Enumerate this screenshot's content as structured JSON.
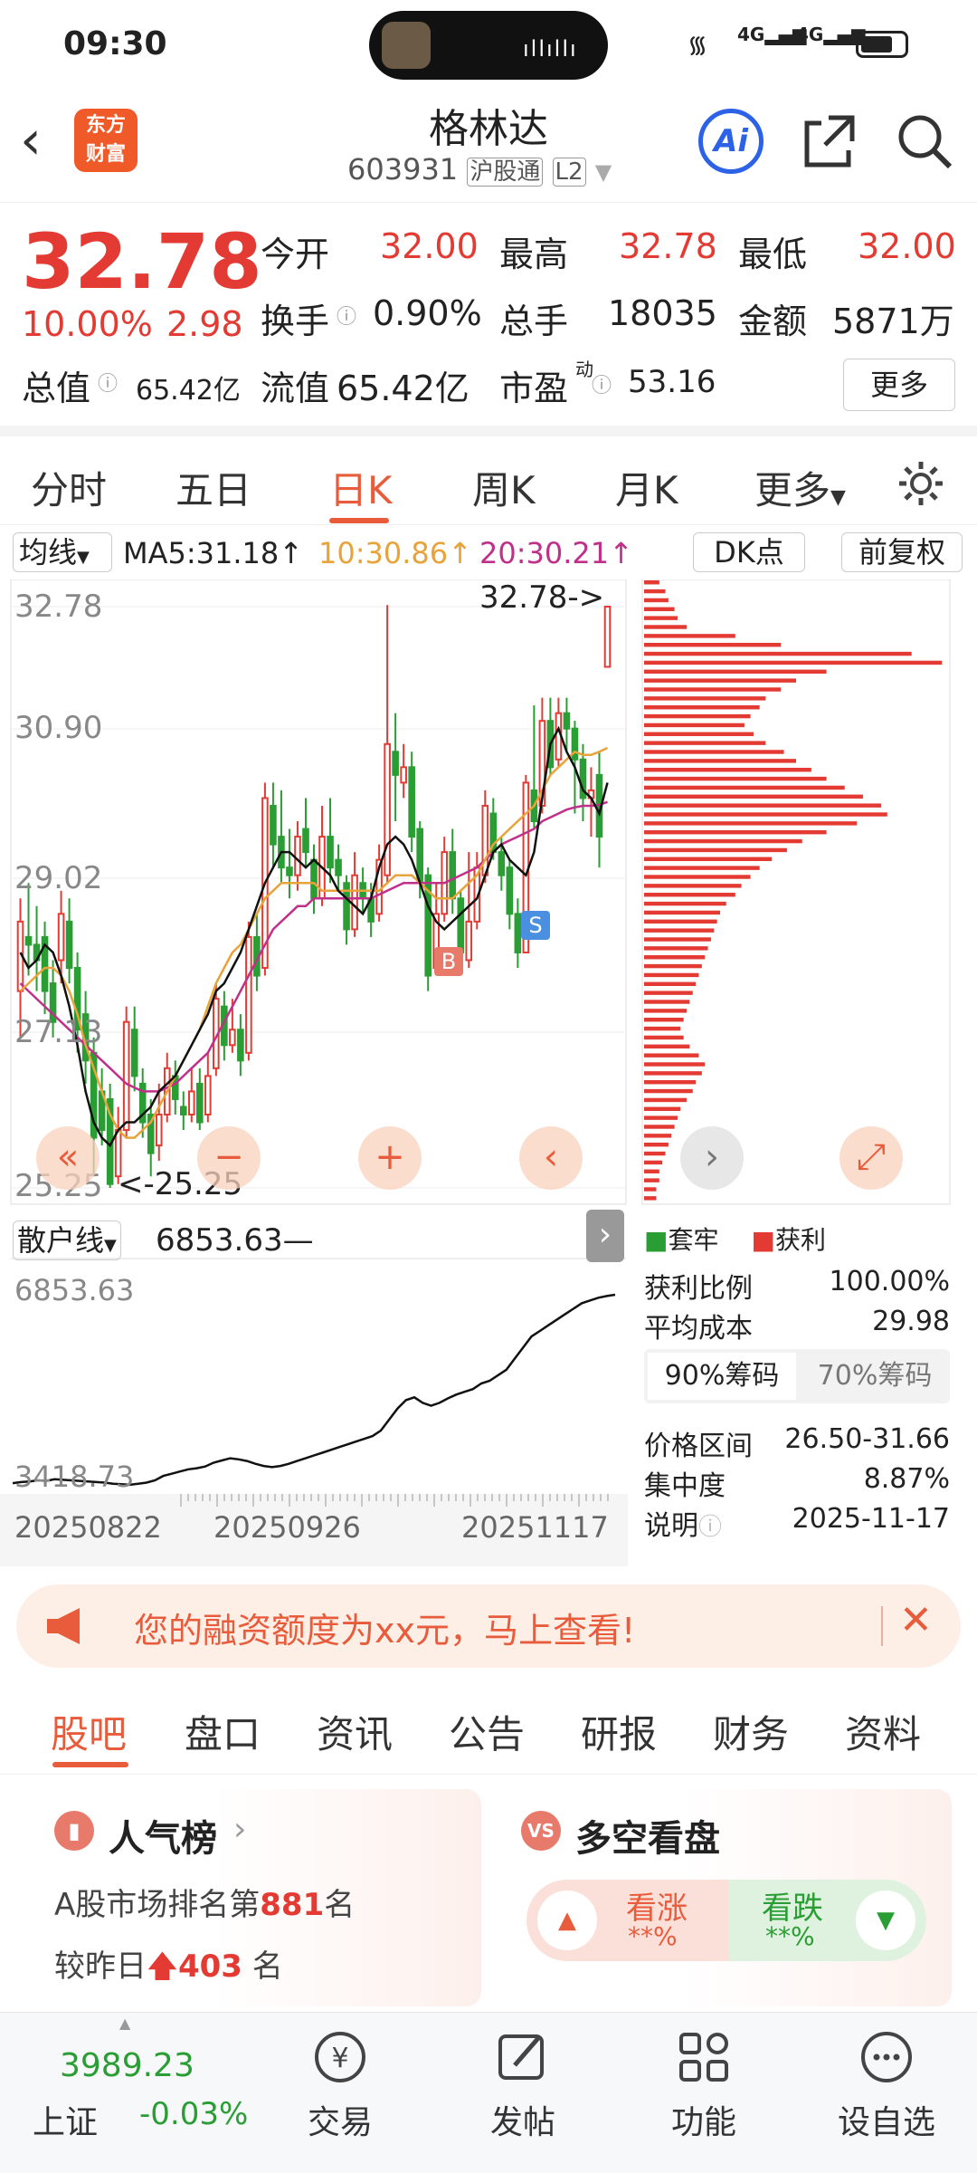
{
  "status": {
    "time": "09:30",
    "net1": "4G",
    "net2": "4G"
  },
  "header": {
    "logo_top": "东方",
    "logo_bottom": "财富",
    "title": "格林达",
    "code": "603931",
    "market": "沪股通",
    "level": "L2",
    "ai_label": "Ai"
  },
  "quote": {
    "price": "32.78",
    "pct": "10.00%",
    "change": "2.98",
    "open_label": "今开",
    "open": "32.00",
    "high_label": "最高",
    "high": "32.78",
    "low_label": "最低",
    "low": "32.00",
    "turnover_label": "换手",
    "turnover": "0.90%",
    "volume_label": "总手",
    "volume": "18035",
    "amount_label": "金额",
    "amount": "5871万",
    "mktcap_label": "总值",
    "mktcap": "65.42亿",
    "float_label": "流值",
    "float": "65.42亿",
    "pe_label": "市盈",
    "pe_sup": "动",
    "pe": "53.16",
    "more": "更多"
  },
  "periods": [
    "分时",
    "五日",
    "日K",
    "周K",
    "月K",
    "更多"
  ],
  "active_period": "日K",
  "indicator": {
    "ma_label": "均线",
    "ma5": "MA5:31.18↑",
    "ma10": "10:30.86↑",
    "ma20": "20:30.21↑",
    "dk": "DK点",
    "fq": "前复权"
  },
  "kline": {
    "y_labels": [
      "32.78",
      "30.90",
      "29.02",
      "27.13",
      "25.25"
    ],
    "max_annot": "32.78->",
    "min_annot": "<-25.25",
    "b_marker": "B",
    "s_marker": "S",
    "candles": [
      [
        27.8,
        28.7,
        27.2,
        29.0
      ],
      [
        28.5,
        28.4,
        28.0,
        29.2
      ],
      [
        28.4,
        28.2,
        27.8,
        28.9
      ],
      [
        28.5,
        27.8,
        27.5,
        28.7
      ],
      [
        27.9,
        27.4,
        27.2,
        28.2
      ],
      [
        28.2,
        28.8,
        27.9,
        29.1
      ],
      [
        28.7,
        28.1,
        27.9,
        29.0
      ],
      [
        28.1,
        27.3,
        27.0,
        28.3
      ],
      [
        27.5,
        26.9,
        26.6,
        27.8
      ],
      [
        27.0,
        25.9,
        25.4,
        27.2
      ],
      [
        26.5,
        26.0,
        25.8,
        26.8
      ],
      [
        26.4,
        25.3,
        25.25,
        26.6
      ],
      [
        25.4,
        26.0,
        25.3,
        26.3
      ],
      [
        26.0,
        27.4,
        25.9,
        27.6
      ],
      [
        27.3,
        26.7,
        26.5,
        27.6
      ],
      [
        26.6,
        26.1,
        25.9,
        26.8
      ],
      [
        26.2,
        25.7,
        25.4,
        26.4
      ],
      [
        25.8,
        26.2,
        25.6,
        26.6
      ],
      [
        26.2,
        26.8,
        26.1,
        27.0
      ],
      [
        26.7,
        26.4,
        26.2,
        26.9
      ],
      [
        26.3,
        26.2,
        26.0,
        26.5
      ],
      [
        26.2,
        26.5,
        26.1,
        26.8
      ],
      [
        26.6,
        26.1,
        26.0,
        26.8
      ],
      [
        26.2,
        26.7,
        26.1,
        27.0
      ],
      [
        26.8,
        27.7,
        26.7,
        27.9
      ],
      [
        27.6,
        27.1,
        26.9,
        27.8
      ],
      [
        27.1,
        27.3,
        27.0,
        27.7
      ],
      [
        27.3,
        26.9,
        26.7,
        27.5
      ],
      [
        27.0,
        28.5,
        26.9,
        28.7
      ],
      [
        28.5,
        28.0,
        27.8,
        28.8
      ],
      [
        28.1,
        30.3,
        28.0,
        30.5
      ],
      [
        30.2,
        29.7,
        29.4,
        30.5
      ],
      [
        29.8,
        29.4,
        29.2,
        30.4
      ],
      [
        29.4,
        29.3,
        29.0,
        29.9
      ],
      [
        29.3,
        29.8,
        29.1,
        30.0
      ],
      [
        29.9,
        29.6,
        29.4,
        30.3
      ],
      [
        29.5,
        29.0,
        28.8,
        29.7
      ],
      [
        29.0,
        29.8,
        28.9,
        30.2
      ],
      [
        29.8,
        29.4,
        29.2,
        30.3
      ],
      [
        29.5,
        29.3,
        29.1,
        29.7
      ],
      [
        29.2,
        28.6,
        28.4,
        29.3
      ],
      [
        28.6,
        29.3,
        28.5,
        29.6
      ],
      [
        29.2,
        29.0,
        28.8,
        29.4
      ],
      [
        29.0,
        28.7,
        28.5,
        29.2
      ],
      [
        28.8,
        29.5,
        28.7,
        29.7
      ],
      [
        29.3,
        31.0,
        29.2,
        32.8
      ],
      [
        30.9,
        30.6,
        30.0,
        31.4
      ],
      [
        30.5,
        30.7,
        30.3,
        31.0
      ],
      [
        30.7,
        29.8,
        29.6,
        30.9
      ],
      [
        29.9,
        29.2,
        29.0,
        30.0
      ],
      [
        29.3,
        28.0,
        27.8,
        29.4
      ],
      [
        28.1,
        28.8,
        28.0,
        29.2
      ],
      [
        28.8,
        29.6,
        28.7,
        29.8
      ],
      [
        29.6,
        29.0,
        28.8,
        29.9
      ],
      [
        29.0,
        28.3,
        28.1,
        29.1
      ],
      [
        28.2,
        28.7,
        28.1,
        29.6
      ],
      [
        28.7,
        29.4,
        28.6,
        29.6
      ],
      [
        29.3,
        30.2,
        29.2,
        30.4
      ],
      [
        30.1,
        29.6,
        29.5,
        30.3
      ],
      [
        29.6,
        29.3,
        29.1,
        29.8
      ],
      [
        29.4,
        28.8,
        28.6,
        29.5
      ],
      [
        28.8,
        28.3,
        28.1,
        29.0
      ],
      [
        28.3,
        30.5,
        28.3,
        30.6
      ],
      [
        30.4,
        30.0,
        29.9,
        31.5
      ],
      [
        30.2,
        31.3,
        30.1,
        31.6
      ],
      [
        31.3,
        30.7,
        30.6,
        31.6
      ],
      [
        30.8,
        31.4,
        30.7,
        31.6
      ],
      [
        31.4,
        31.2,
        30.9,
        31.6
      ],
      [
        31.2,
        30.8,
        30.1,
        31.3
      ],
      [
        30.8,
        30.3,
        30.0,
        31.0
      ],
      [
        30.3,
        30.4,
        29.8,
        30.7
      ],
      [
        30.6,
        29.8,
        29.4,
        30.9
      ],
      [
        32.0,
        32.78,
        32.0,
        32.78
      ]
    ],
    "ma_black": [
      28.3,
      28.1,
      28.2,
      28.4,
      28.3,
      28.0,
      27.6,
      27.1,
      26.5,
      26.1,
      25.9,
      25.8,
      26.0,
      26.1,
      26.1,
      26.2,
      26.3,
      26.5,
      26.6,
      26.7,
      26.9,
      27.1,
      27.3,
      27.5,
      27.8,
      27.9,
      28.1,
      28.3,
      28.6,
      28.9,
      29.2,
      29.4,
      29.6,
      29.6,
      29.5,
      29.4,
      29.5,
      29.4,
      29.3,
      29.1,
      29.0,
      28.9,
      28.8,
      29.0,
      29.4,
      29.7,
      29.8,
      29.7,
      29.5,
      29.2,
      28.9,
      28.7,
      28.6,
      28.7,
      28.8,
      28.9,
      29.0,
      29.3,
      29.6,
      29.7,
      29.5,
      29.4,
      29.3,
      29.6,
      30.3,
      31.0,
      31.2,
      30.9,
      30.7,
      30.4,
      30.3,
      30.1,
      30.5
    ],
    "ma_yellow": [
      27.8,
      27.9,
      28.0,
      28.1,
      28.1,
      28.0,
      27.8,
      27.5,
      27.1,
      26.8,
      26.5,
      26.2,
      26.0,
      25.9,
      25.9,
      26.0,
      26.1,
      26.3,
      26.5,
      26.7,
      26.9,
      27.1,
      27.3,
      27.6,
      27.9,
      28.1,
      28.3,
      28.4,
      28.6,
      28.8,
      29.0,
      29.1,
      29.2,
      29.2,
      29.2,
      29.2,
      29.2,
      29.1,
      29.1,
      29.1,
      29.1,
      29.1,
      29.1,
      29.1,
      29.1,
      29.2,
      29.3,
      29.3,
      29.3,
      29.2,
      29.1,
      29.0,
      29.0,
      29.0,
      29.1,
      29.2,
      29.3,
      29.5,
      29.7,
      29.8,
      29.9,
      30.0,
      30.1,
      30.2,
      30.4,
      30.6,
      30.7,
      30.8,
      30.9,
      30.86,
      30.86,
      30.9,
      30.95
    ],
    "ma_pink": [
      27.9,
      27.8,
      27.7,
      27.6,
      27.5,
      27.4,
      27.3,
      27.2,
      27.1,
      27.0,
      26.9,
      26.8,
      26.7,
      26.6,
      26.55,
      26.5,
      26.5,
      26.5,
      26.55,
      26.6,
      26.7,
      26.8,
      26.9,
      27.0,
      27.2,
      27.4,
      27.6,
      27.8,
      28.0,
      28.2,
      28.4,
      28.6,
      28.7,
      28.8,
      28.9,
      28.9,
      29.0,
      29.0,
      29.0,
      29.0,
      29.0,
      29.0,
      29.0,
      29.0,
      29.05,
      29.1,
      29.15,
      29.2,
      29.2,
      29.2,
      29.2,
      29.2,
      29.2,
      29.25,
      29.3,
      29.35,
      29.4,
      29.5,
      29.6,
      29.7,
      29.75,
      29.8,
      29.85,
      29.9,
      30.0,
      30.05,
      30.1,
      30.15,
      30.18,
      30.2,
      30.2,
      30.21,
      30.25
    ]
  },
  "chips": {
    "legend_trapped": "套牢",
    "legend_profit": "获利",
    "ratio_label": "获利比例",
    "ratio": "100.00%",
    "avg_label": "平均成本",
    "avg": "29.98",
    "tab90": "90%筹码",
    "tab70": "70%筹码",
    "range_label": "价格区间",
    "range": "26.50-31.66",
    "conc_label": "集中度",
    "conc": "8.87%",
    "note_label": "说明",
    "date": "2025-11-17",
    "bars": [
      0.05,
      0.07,
      0.08,
      0.1,
      0.11,
      0.14,
      0.3,
      0.45,
      0.88,
      0.98,
      0.6,
      0.5,
      0.45,
      0.4,
      0.38,
      0.35,
      0.33,
      0.36,
      0.4,
      0.46,
      0.5,
      0.55,
      0.6,
      0.66,
      0.72,
      0.78,
      0.8,
      0.7,
      0.6,
      0.52,
      0.47,
      0.42,
      0.38,
      0.35,
      0.32,
      0.3,
      0.27,
      0.25,
      0.24,
      0.23,
      0.22,
      0.21,
      0.2,
      0.19,
      0.18,
      0.17,
      0.16,
      0.15,
      0.14,
      0.13,
      0.12,
      0.13,
      0.15,
      0.18,
      0.2,
      0.19,
      0.17,
      0.16,
      0.14,
      0.12,
      0.11,
      0.1,
      0.09,
      0.08,
      0.07,
      0.06,
      0.05,
      0.05,
      0.04,
      0.04
    ]
  },
  "retail": {
    "label": "散户线",
    "value": "6853.63—",
    "y_top": "6853.63",
    "y_bottom": "3418.73",
    "x_dates": [
      "20250822",
      "20250926",
      "20251117"
    ],
    "series": [
      3450,
      3470,
      3480,
      3500,
      3490,
      3520,
      3510,
      3500,
      3490,
      3480,
      3470,
      3460,
      3440,
      3430,
      3420,
      3440,
      3460,
      3500,
      3580,
      3620,
      3660,
      3700,
      3720,
      3750,
      3820,
      3860,
      3900,
      3880,
      3850,
      3800,
      3760,
      3740,
      3760,
      3800,
      3850,
      3900,
      3950,
      4000,
      4050,
      4100,
      4150,
      4200,
      4250,
      4300,
      4400,
      4600,
      4800,
      4950,
      5000,
      4900,
      4850,
      4900,
      4980,
      5050,
      5100,
      5150,
      5250,
      5300,
      5400,
      5500,
      5700,
      5900,
      6100,
      6200,
      6300,
      6400,
      6500,
      6600,
      6700,
      6750,
      6800,
      6830,
      6853
    ]
  },
  "banner": {
    "text": "您的融资额度为xx元，马上查看!"
  },
  "subtabs": [
    "股吧",
    "盘口",
    "资讯",
    "公告",
    "研报",
    "财务",
    "资料"
  ],
  "active_subtab": "股吧",
  "cards": {
    "pop_title": "人气榜",
    "pop_line1a": "A股市场排名第",
    "pop_rank": "881",
    "pop_line1b": "名",
    "pop_line2a": "较昨日",
    "pop_change": "403",
    "pop_line2b": "名",
    "bull_title": "多空看盘",
    "rise_label": "看涨",
    "rise_val": "**%",
    "fall_label": "看跌",
    "fall_val": "**%"
  },
  "bottom": {
    "index_value": "3989.23",
    "index_name": "上证",
    "index_change": "-0.03%",
    "nav": [
      "交易",
      "发帖",
      "功能",
      "设自选"
    ]
  },
  "colors": {
    "up": "#e33b33",
    "down": "#2a9d34",
    "accent": "#e85c3c"
  }
}
